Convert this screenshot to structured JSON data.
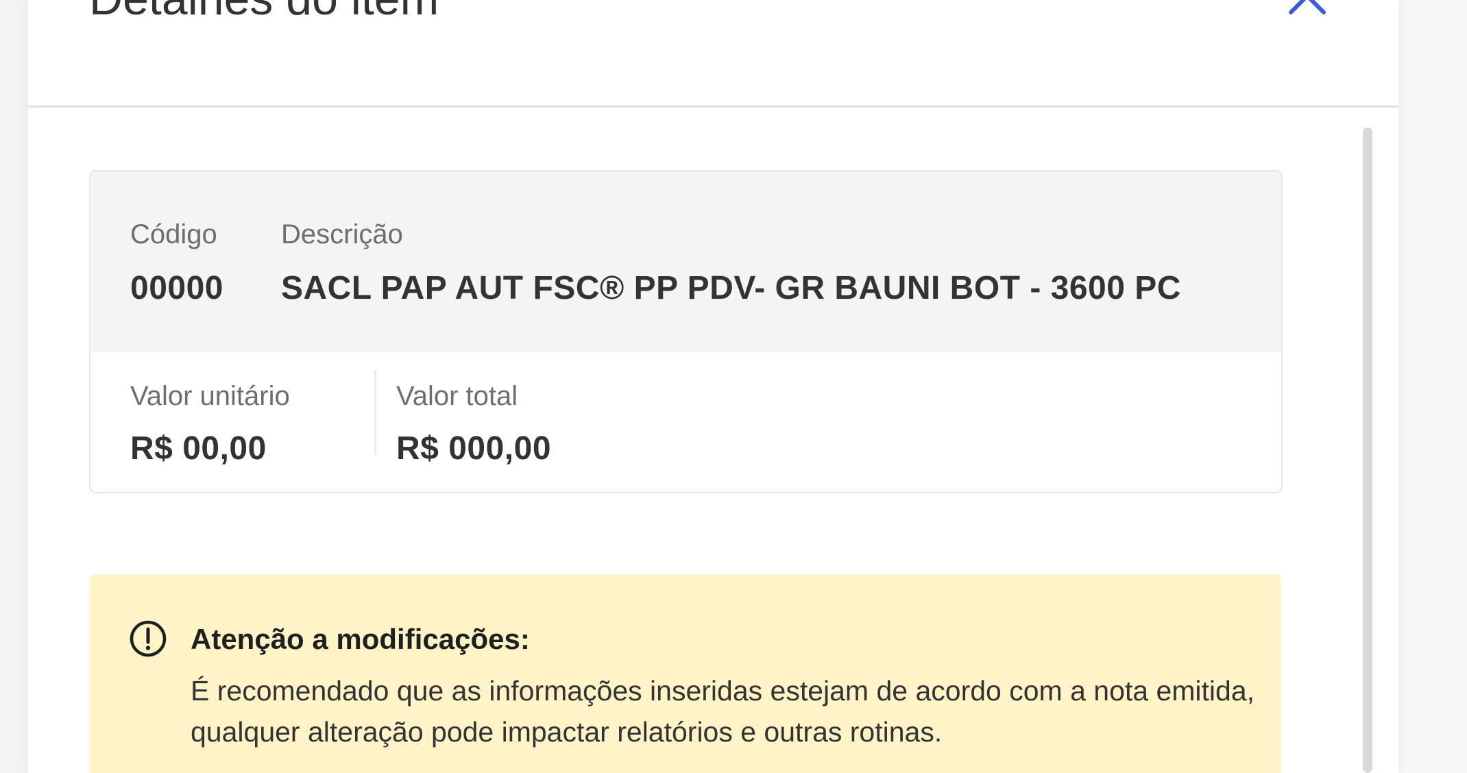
{
  "panel": {
    "title": "Detalhes do item"
  },
  "item": {
    "code_label": "Código",
    "code_value": "00000",
    "description_label": "Descrição",
    "description_value": "SACL PAP AUT FSC® PP PDV- GR BAUNI BOT - 3600 PC",
    "unit_price_label": "Valor unitário",
    "unit_price_value": "R$ 00,00",
    "total_price_label": "Valor total",
    "total_price_value": "R$ 000,00"
  },
  "alert": {
    "icon": "exclamation-circle-icon",
    "title": "Atenção a modificações:",
    "message": "É recomendado que as informações inseridas estejam de acordo com a nota emitida, qualquer alteração pode impactar relatórios e outras rotinas."
  },
  "colors": {
    "accent": "#3b5bdb",
    "alert_background": "#fff4c7",
    "card_header_background": "#f4f4f4"
  }
}
